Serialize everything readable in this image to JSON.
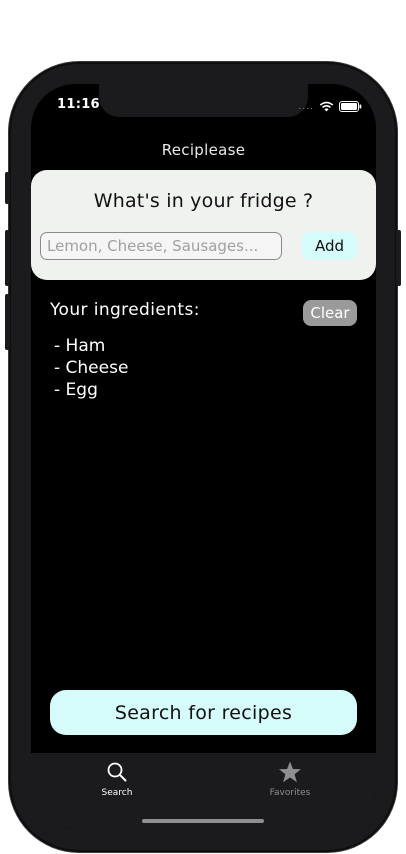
{
  "status_bar": {
    "time": "11:16",
    "signal_dots": "....",
    "wifi_icon": "wifi-icon",
    "battery_icon": "battery-icon"
  },
  "nav": {
    "title": "Reciplease"
  },
  "search_card": {
    "question": "What's in your fridge ?",
    "input_placeholder": "Lemon, Cheese, Sausages...",
    "input_value": "",
    "add_label": "Add"
  },
  "ingredients": {
    "label": "Your ingredients:",
    "clear_label": "Clear",
    "items": [
      "- Ham",
      "- Cheese",
      "- Egg"
    ]
  },
  "search_recipes_label": "Search for recipes",
  "tab_bar": {
    "tabs": [
      {
        "label": "Search",
        "icon": "magnifier-icon",
        "selected": true
      },
      {
        "label": "Favorites",
        "icon": "star-icon",
        "selected": false
      }
    ]
  },
  "colors": {
    "accent_cyan": "#d6fbfb",
    "card_background": "#f0f2f0",
    "screen_background": "#000000",
    "tab_bar_background": "#1b1b1d",
    "clear_button": "#9a9a9a",
    "tab_selected": "#ffffff",
    "tab_unselected": "#8e8e93"
  }
}
